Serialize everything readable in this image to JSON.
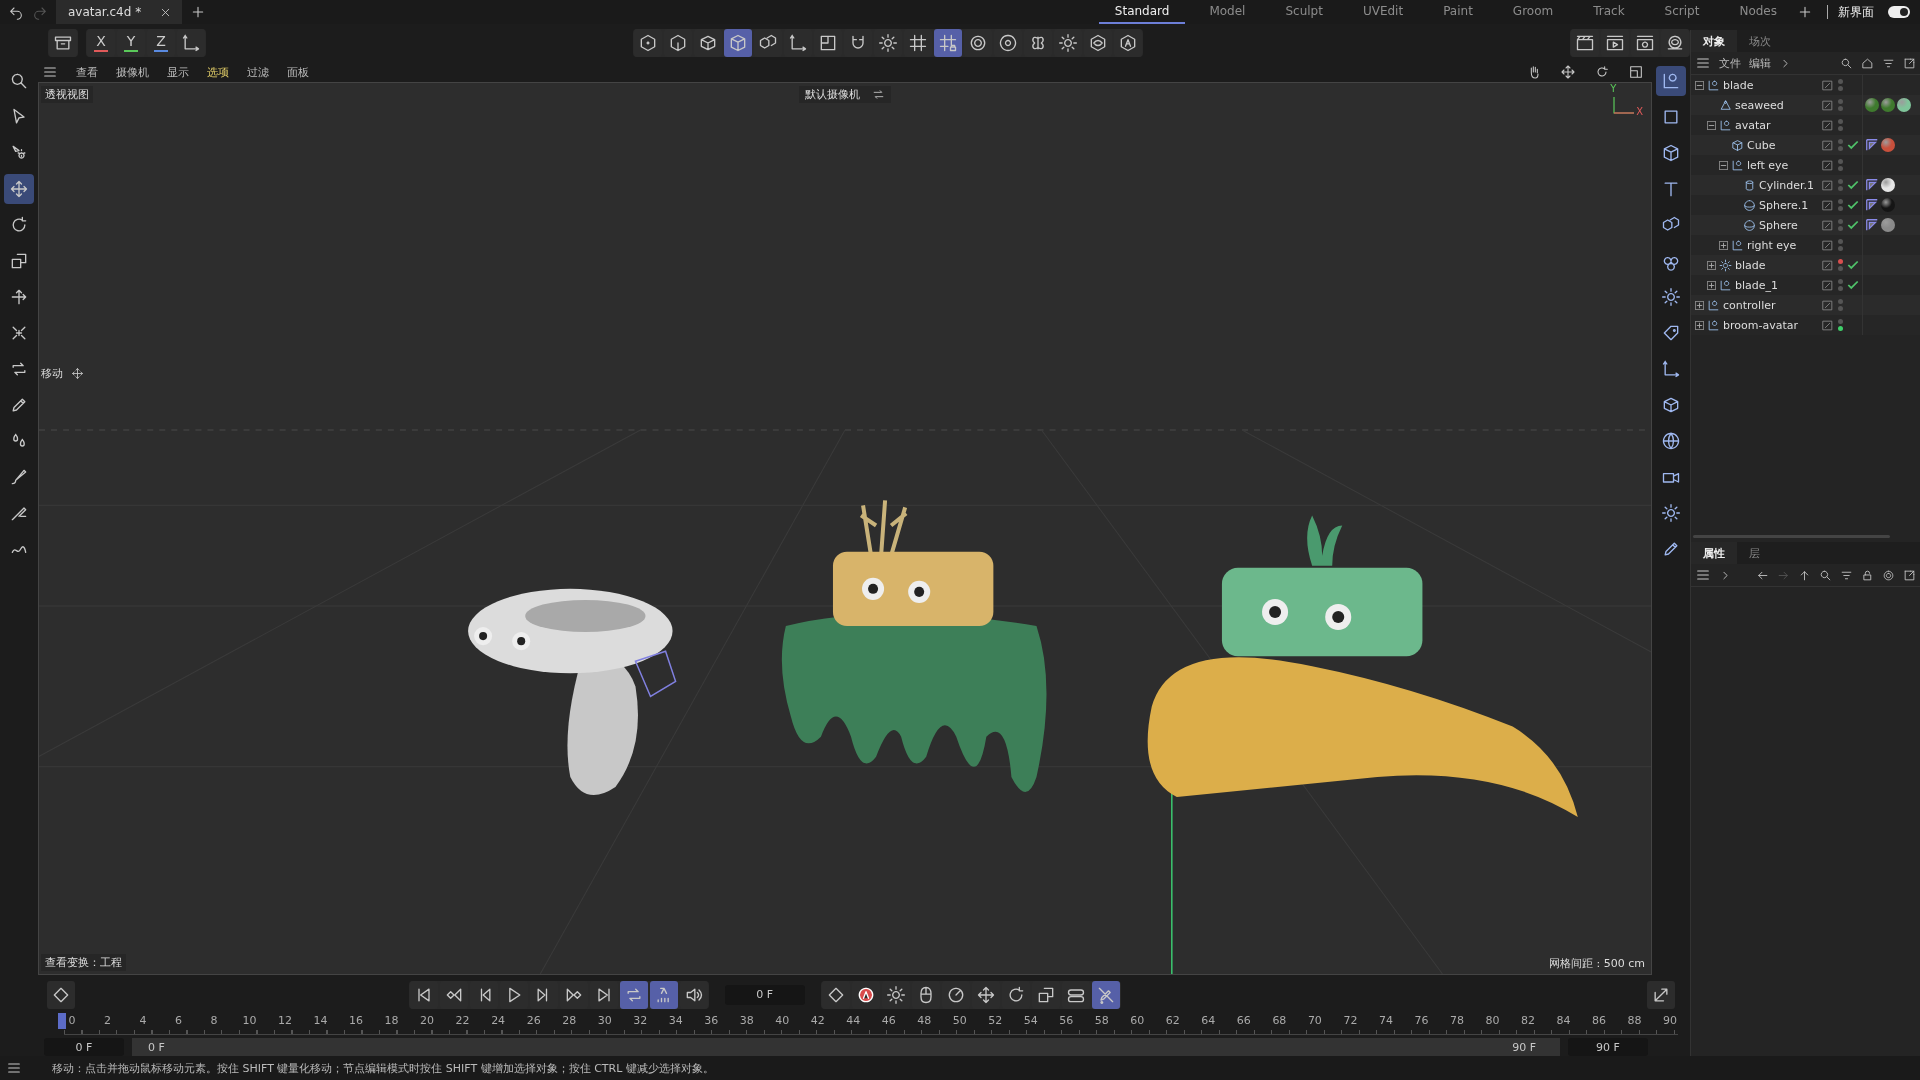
{
  "title_bar": {
    "document_tab": {
      "label": "avatar.c4d *",
      "selected": true
    },
    "layouts": [
      {
        "label": "Standard",
        "selected": true
      },
      {
        "label": "Model",
        "selected": false
      },
      {
        "label": "Sculpt",
        "selected": false
      },
      {
        "label": "UVEdit",
        "selected": false
      },
      {
        "label": "Paint",
        "selected": false
      },
      {
        "label": "Groom",
        "selected": false
      },
      {
        "label": "Track",
        "selected": false
      },
      {
        "label": "Script",
        "selected": false
      },
      {
        "label": "Nodes",
        "selected": false
      }
    ],
    "new_ui": {
      "label": "新界面",
      "on": true
    }
  },
  "toolbar": {
    "axis_buttons": [
      {
        "label": "X",
        "color": "#e05a5a"
      },
      {
        "label": "Y",
        "color": "#5ac85a"
      },
      {
        "label": "Z",
        "color": "#5a8ae0"
      }
    ],
    "mode_buttons": [
      {
        "kind": "dot-hexagon",
        "selected": false
      },
      {
        "kind": "edge-hexagon",
        "selected": false
      },
      {
        "kind": "cube-face",
        "selected": false
      },
      {
        "kind": "cube-solid",
        "selected": true
      },
      {
        "kind": "cubes",
        "selected": false
      },
      {
        "kind": "axis-corner",
        "selected": false
      },
      {
        "kind": "square-half",
        "selected": false
      },
      {
        "kind": "magnet",
        "selected": false
      },
      {
        "kind": "gear",
        "selected": false
      },
      {
        "kind": "grid",
        "selected": false
      },
      {
        "kind": "grid-lock",
        "selected": true
      },
      {
        "kind": "target",
        "selected": false
      },
      {
        "kind": "gear-circle",
        "selected": false
      },
      {
        "kind": "butterfly",
        "selected": false
      },
      {
        "kind": "gear",
        "selected": false
      },
      {
        "kind": "eye-hexagon",
        "selected": false
      },
      {
        "kind": "hexagon",
        "selected": false
      }
    ],
    "render_buttons": [
      {
        "kind": "film"
      },
      {
        "kind": "film-play"
      },
      {
        "kind": "film-gear"
      },
      {
        "kind": "ring"
      }
    ]
  },
  "viewport_menu": [
    {
      "label": "查看",
      "selected": false
    },
    {
      "label": "摄像机",
      "selected": false
    },
    {
      "label": "显示",
      "selected": false
    },
    {
      "label": "选项",
      "selected": true
    },
    {
      "label": "过滤",
      "selected": false
    },
    {
      "label": "面板",
      "selected": false
    }
  ],
  "viewport": {
    "view_name": "透视视图",
    "camera": "默认摄像机",
    "tool_label": "移动",
    "axis_labels": [
      "Y",
      "X"
    ],
    "transform_info": "查看变换：工程",
    "grid_spacing": "网格间距 : 500 cm"
  },
  "left_tools": [
    {
      "kind": "search",
      "selected": false
    },
    {
      "kind": "cursor",
      "selected": false
    },
    {
      "kind": "gear-arrow",
      "selected": false
    },
    {
      "kind": "move",
      "selected": true
    },
    {
      "kind": "rotate",
      "selected": false
    },
    {
      "kind": "scale",
      "selected": false
    },
    {
      "kind": "arrows",
      "selected": false
    },
    {
      "kind": "scatter",
      "selected": false
    },
    {
      "kind": "loop",
      "selected": false
    },
    {
      "kind": "pen",
      "selected": false
    },
    {
      "kind": "drops",
      "selected": false
    },
    {
      "kind": "brush",
      "selected": false
    },
    {
      "kind": "knife",
      "selected": false
    },
    {
      "kind": "spline",
      "selected": false
    }
  ],
  "right_tools": [
    {
      "kind": "null-corner",
      "selected": true
    },
    {
      "kind": "square",
      "selected": false
    },
    {
      "kind": "cube-solid",
      "selected": false
    },
    {
      "kind": "letter-t",
      "selected": false
    },
    {
      "kind": "cubes",
      "selected": false
    },
    {
      "kind": "blob",
      "selected": false
    },
    {
      "kind": "gear",
      "selected": false
    },
    {
      "kind": "tag",
      "selected": false
    },
    {
      "kind": "axis-corner",
      "selected": false
    },
    {
      "kind": "cube-face",
      "selected": false
    },
    {
      "kind": "globe",
      "selected": false
    },
    {
      "kind": "camera",
      "selected": false
    },
    {
      "kind": "sun",
      "selected": false
    },
    {
      "kind": "pen",
      "selected": false
    }
  ],
  "object_manager": {
    "tabs": [
      {
        "label": "对象",
        "selected": true
      },
      {
        "label": "场次",
        "selected": false
      }
    ],
    "menu": [
      "文件",
      "编辑"
    ],
    "objects": [
      {
        "name": "blade",
        "kind": "null",
        "expanded": true,
        "check": false,
        "children": [
          {
            "name": "seaweed",
            "kind": "spline",
            "check": false,
            "tags": [
              {
                "kind": "material",
                "color": "#3f7a2e"
              },
              {
                "kind": "material",
                "color": "#3f7a2e"
              },
              {
                "kind": "material",
                "color": "#7fc49a"
              }
            ]
          },
          {
            "name": "avatar",
            "kind": "null",
            "expanded": true,
            "check": false,
            "children": [
              {
                "name": "Cube",
                "kind": "cube",
                "check": true,
                "tags": [
                  {
                    "kind": "texture"
                  },
                  {
                    "kind": "material",
                    "color": "#c8503c"
                  }
                ]
              },
              {
                "name": "left eye",
                "kind": "null",
                "expanded": true,
                "check": false,
                "children": [
                  {
                    "name": "Cylinder.1",
                    "kind": "cylinder",
                    "check": true,
                    "tags": [
                      {
                        "kind": "texture"
                      },
                      {
                        "kind": "material",
                        "color": "#e6e6e6"
                      }
                    ]
                  },
                  {
                    "name": "Sphere.1",
                    "kind": "sphere",
                    "check": true,
                    "tags": [
                      {
                        "kind": "texture"
                      },
                      {
                        "kind": "material",
                        "color": "#151515"
                      }
                    ]
                  },
                  {
                    "name": "Sphere",
                    "kind": "sphere",
                    "check": true,
                    "tags": [
                      {
                        "kind": "texture"
                      },
                      {
                        "kind": "material",
                        "color": "#8a8a8a"
                      }
                    ]
                  }
                ]
              },
              {
                "name": "right eye",
                "kind": "null",
                "expanded": false,
                "check": false
              }
            ]
          },
          {
            "name": "blade",
            "kind": "generator",
            "expanded": false,
            "check": true,
            "editor_dot": {
              "color": "#d94f4f"
            }
          },
          {
            "name": "blade_1",
            "kind": "null",
            "expanded": false,
            "check": true
          }
        ]
      },
      {
        "name": "controller",
        "kind": "null",
        "expanded": false,
        "check": false
      },
      {
        "name": "broom-avatar",
        "kind": "null",
        "expanded": false,
        "check": false,
        "render_dot": {
          "color": "#3fcf6a"
        }
      }
    ]
  },
  "attributes": {
    "tabs": [
      {
        "label": "属性",
        "selected": true
      },
      {
        "label": "层",
        "selected": false
      }
    ]
  },
  "timeline": {
    "current_frame": "0 F",
    "transport": [
      {
        "kind": "first",
        "selected": false
      },
      {
        "kind": "prev-key",
        "selected": false
      },
      {
        "kind": "prev",
        "selected": false
      },
      {
        "kind": "play",
        "selected": false
      },
      {
        "kind": "next",
        "selected": false
      },
      {
        "kind": "next-key",
        "selected": false
      },
      {
        "kind": "last",
        "selected": false
      },
      {
        "kind": "loop",
        "selected": true
      },
      {
        "kind": "bars",
        "selected": true
      },
      {
        "kind": "speaker",
        "selected": false
      }
    ],
    "record_buttons": [
      {
        "kind": "record",
        "selected": false
      },
      {
        "kind": "autokey",
        "selected": false
      },
      {
        "kind": "gear",
        "selected": false
      },
      {
        "kind": "mouse",
        "selected": false
      },
      {
        "kind": "dial",
        "selected": false
      },
      {
        "kind": "move",
        "selected": false
      },
      {
        "kind": "rotate",
        "selected": false
      },
      {
        "kind": "scale",
        "selected": false
      },
      {
        "kind": "toggle",
        "selected": false
      },
      {
        "kind": "pen-off",
        "selected": true
      }
    ],
    "ruler": [
      "0",
      "2",
      "4",
      "6",
      "8",
      "10",
      "12",
      "14",
      "16",
      "18",
      "20",
      "22",
      "24",
      "26",
      "28",
      "30",
      "32",
      "34",
      "36",
      "38",
      "40",
      "42",
      "44",
      "46",
      "48",
      "50",
      "52",
      "54",
      "56",
      "58",
      "60",
      "62",
      "64",
      "66",
      "68",
      "70",
      "72",
      "74",
      "76",
      "78",
      "80",
      "82",
      "84",
      "86",
      "88",
      "90"
    ],
    "start_frame": "0 F",
    "range_start": "0 F",
    "range_end": "90 F",
    "end_frame": "90 F"
  },
  "status_bar": "移动：点击并拖动鼠标移动元素。按住 SHIFT 键量化移动；节点编辑模式时按住 SHIFT 键增加选择对象；按住 CTRL 键减少选择对象。"
}
